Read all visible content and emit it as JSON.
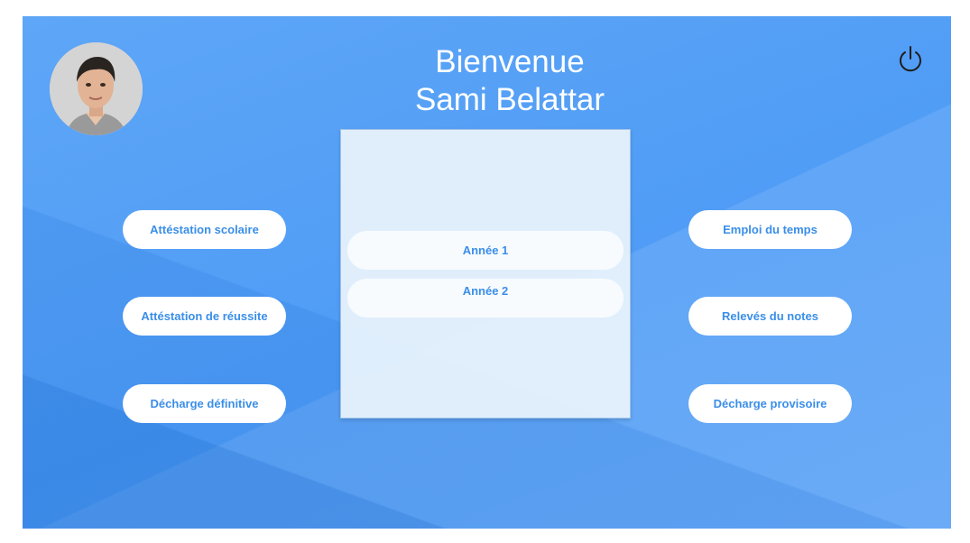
{
  "header": {
    "welcome_line": "Bienvenue",
    "user_name": "Sami Belattar"
  },
  "user": {
    "avatar_icon": "user-photo"
  },
  "toolbar": {
    "power_icon": "power-icon"
  },
  "left_buttons": [
    {
      "label": "Attéstation scolaire"
    },
    {
      "label": "Attéstation de réussite"
    },
    {
      "label": "Décharge définitive"
    }
  ],
  "right_buttons": [
    {
      "label": "Emploi du temps"
    },
    {
      "label": "Relevés du notes"
    },
    {
      "label": "Décharge provisoire"
    }
  ],
  "year_panel": {
    "items": [
      {
        "label": "Année 1"
      },
      {
        "label": "Année 2"
      }
    ]
  },
  "colors": {
    "background": "#4f9cf6",
    "accent_text": "#3a8ee8",
    "button_bg": "#ffffff"
  }
}
